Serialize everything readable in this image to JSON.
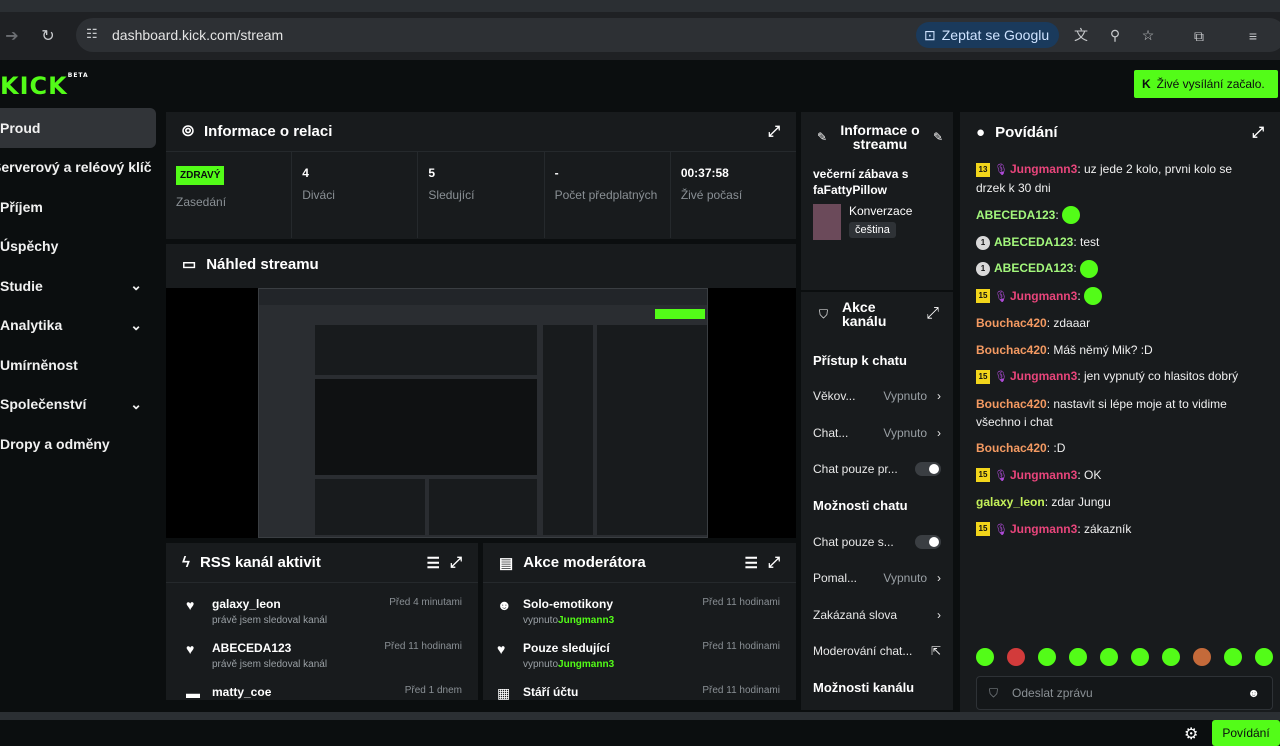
{
  "browser": {
    "url": "dashboard.kick.com/stream",
    "google_label": "Zeptat se Googlu"
  },
  "header": {
    "logo": "KICK",
    "logo_beta": "BETA",
    "live_label": "Živé vysílání začalo."
  },
  "sidebar": {
    "items": [
      {
        "label": "Proud",
        "chevron": false
      },
      {
        "label": "Serverový a reléový klíč",
        "chevron": false
      },
      {
        "label": "Příjem",
        "chevron": false
      },
      {
        "label": "Úspěchy",
        "chevron": false
      },
      {
        "label": "Studie",
        "chevron": true
      },
      {
        "label": "Analytika",
        "chevron": true
      },
      {
        "label": "Umírněnost",
        "chevron": false
      },
      {
        "label": "Společenství",
        "chevron": true
      },
      {
        "label": "Dropy a odměny",
        "chevron": false
      }
    ]
  },
  "session": {
    "title": "Informace o relaci",
    "stats": [
      {
        "value": "ZDRAVÝ",
        "label": "Zasedání"
      },
      {
        "value": "4",
        "label": "Diváci"
      },
      {
        "value": "5",
        "label": "Sledující"
      },
      {
        "value": "-",
        "label": "Počet předplatných"
      },
      {
        "value": "00:37:58",
        "label": "Živé počasí"
      }
    ]
  },
  "preview": {
    "title": "Náhled streamu"
  },
  "stream_info": {
    "title": "Informace o streamu",
    "stream_title": "večerní zábava s faFattyPillow",
    "category": "Konverzace",
    "language": "čeština"
  },
  "channel_actions": {
    "title": "Akce kanálu",
    "sections": [
      {
        "heading": "Přístup k chatu",
        "rows": [
          {
            "label": "Věkov...",
            "value": "Vypnuto",
            "control": "chevron"
          },
          {
            "label": "Chat...",
            "value": "Vypnuto",
            "control": "chevron"
          },
          {
            "label": "Chat pouze pr...",
            "value": "",
            "control": "toggle"
          }
        ]
      },
      {
        "heading": "Možnosti chatu",
        "rows": [
          {
            "label": "Chat pouze s...",
            "value": "",
            "control": "toggle"
          },
          {
            "label": "Pomal...",
            "value": "Vypnuto",
            "control": "chevron"
          },
          {
            "label": "Zakázaná slova",
            "value": "",
            "control": "chevron"
          },
          {
            "label": "Moderování chat...",
            "value": "",
            "control": "external"
          }
        ]
      },
      {
        "heading": "Možnosti kanálu",
        "rows": []
      }
    ]
  },
  "chat": {
    "title": "Povídání",
    "messages": [
      {
        "badge": "13",
        "badge_type": "y",
        "user": "Jungmann3",
        "color": "pink",
        "text": "uz jede 2 kolo, prvni kolo se drzek k 30 dni",
        "emote": false,
        "mic": true
      },
      {
        "badge": "",
        "badge_type": "",
        "user": "ABECEDA123",
        "color": "green",
        "text": "",
        "emote": true,
        "mic": false
      },
      {
        "badge": "1",
        "badge_type": "g",
        "user": "ABECEDA123",
        "color": "green",
        "text": "test",
        "emote": false,
        "mic": false
      },
      {
        "badge": "1",
        "badge_type": "g",
        "user": "ABECEDA123",
        "color": "green",
        "text": "",
        "emote": true,
        "mic": false
      },
      {
        "badge": "15",
        "badge_type": "y",
        "user": "Jungmann3",
        "color": "pink",
        "text": "",
        "emote": true,
        "mic": true
      },
      {
        "badge": "",
        "badge_type": "",
        "user": "Bouchac420",
        "color": "orange",
        "text": "zdaaar",
        "emote": false,
        "mic": false
      },
      {
        "badge": "",
        "badge_type": "",
        "user": "Bouchac420",
        "color": "orange",
        "text": "Máš němý Mik? :D",
        "emote": false,
        "mic": false
      },
      {
        "badge": "15",
        "badge_type": "y",
        "user": "Jungmann3",
        "color": "pink",
        "text": "jen vypnutý co hlasitos dobrý",
        "emote": false,
        "mic": true
      },
      {
        "badge": "",
        "badge_type": "",
        "user": "Bouchac420",
        "color": "orange",
        "text": "nastavit si lépe moje at to vidime všechno i chat",
        "emote": false,
        "mic": false
      },
      {
        "badge": "",
        "badge_type": "",
        "user": "Bouchac420",
        "color": "orange",
        "text": ":D",
        "emote": false,
        "mic": false
      },
      {
        "badge": "15",
        "badge_type": "y",
        "user": "Jungmann3",
        "color": "pink",
        "text": "OK",
        "emote": false,
        "mic": true
      },
      {
        "badge": "",
        "badge_type": "",
        "user": "galaxy_leon",
        "color": "lime",
        "text": "zdar Jungu",
        "emote": false,
        "mic": false
      },
      {
        "badge": "15",
        "badge_type": "y",
        "user": "Jungmann3",
        "color": "pink",
        "text": "zákazník",
        "emote": false,
        "mic": true
      }
    ],
    "input_placeholder": "Odeslat zprávu",
    "send_label": "Povídání"
  },
  "rss": {
    "title": "RSS kanál aktivit",
    "items": [
      {
        "name": "galaxy_leon",
        "sub": "právě jsem sledoval kanál",
        "time": "Před 4 minutami"
      },
      {
        "name": "ABECEDA123",
        "sub": "právě jsem sledoval kanál",
        "time": "Před 11 hodinami"
      },
      {
        "name": "matty_coe",
        "sub": "",
        "time": "Před 1 dnem"
      }
    ]
  },
  "mod_actions": {
    "title": "Akce moderátora",
    "items": [
      {
        "name": "Solo-emotikony",
        "sub_prefix": "vypnuto",
        "sub_user": "Jungmann3",
        "time": "Před 11 hodinami"
      },
      {
        "name": "Pouze sledující",
        "sub_prefix": "vypnuto",
        "sub_user": "Jungmann3",
        "time": "Před 11 hodinami"
      },
      {
        "name": "Stáří účtu",
        "sub_prefix": "",
        "sub_user": "",
        "time": "Před 11 hodinami"
      }
    ]
  },
  "colors": {
    "accent": "#53fc18",
    "panel": "#181b1d",
    "bg": "#0b0e0f"
  }
}
